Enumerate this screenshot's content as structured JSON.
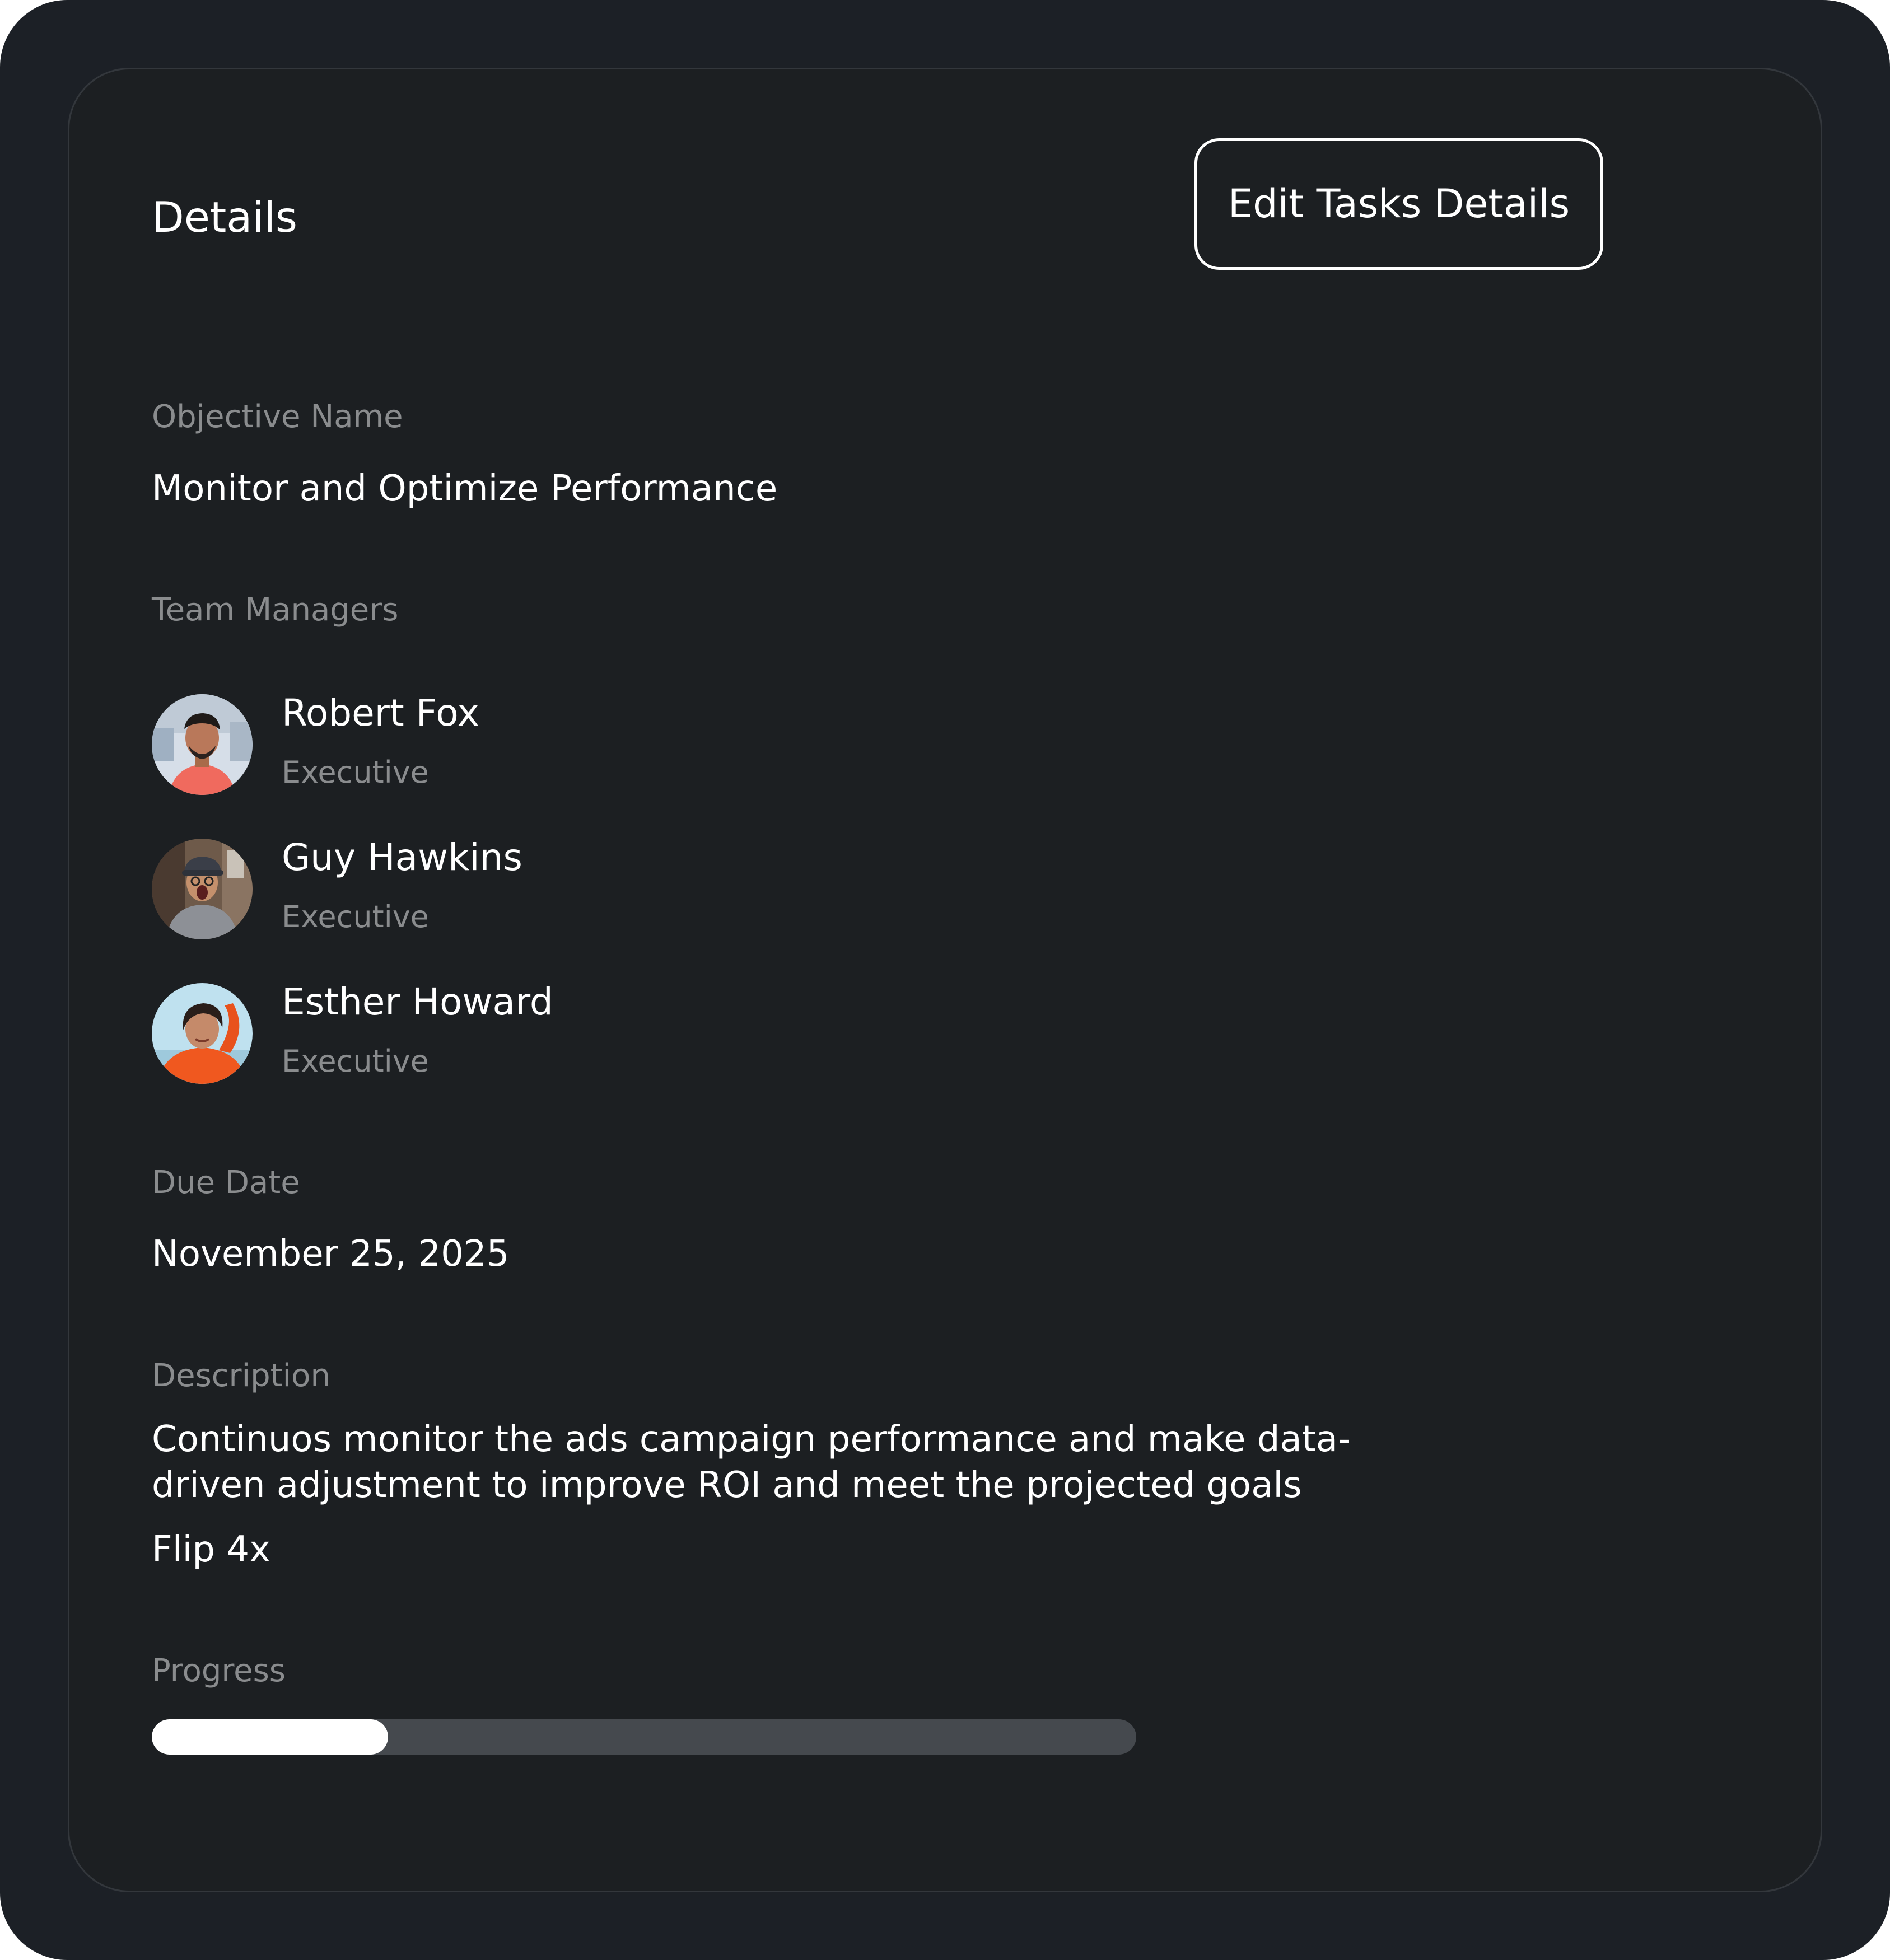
{
  "header": {
    "title": "Details",
    "edit_button_label": "Edit Tasks Details"
  },
  "objective": {
    "label": "Objective Name",
    "value": "Monitor and Optimize Performance"
  },
  "team": {
    "label": "Team Managers",
    "members": [
      {
        "name": "Robert Fox",
        "role": "Executive"
      },
      {
        "name": "Guy Hawkins",
        "role": "Executive"
      },
      {
        "name": "Esther Howard",
        "role": "Executive"
      }
    ]
  },
  "due_date": {
    "label": "Due Date",
    "value": "November 25, 2025"
  },
  "description": {
    "label": "Description",
    "text": "Continuos monitor the ads campaign performance and make data-driven adjustment to improve ROI and meet the projected goals",
    "extra": "Flip 4x"
  },
  "progress": {
    "label": "Progress",
    "percent": 24
  },
  "colors": {
    "background": "#1c2026",
    "card": "#1c1f22",
    "muted_text": "#8a8c8e",
    "track": "#45494e",
    "fill": "#ffffff"
  }
}
